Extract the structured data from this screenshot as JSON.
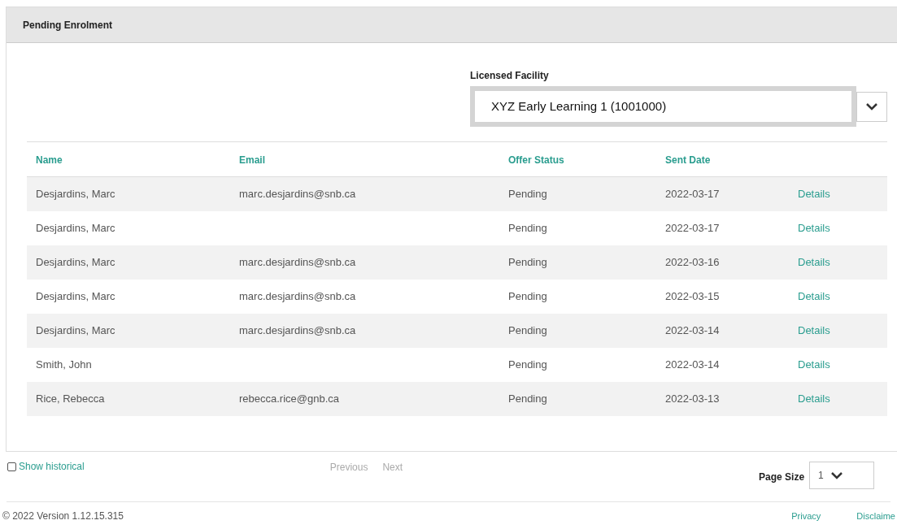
{
  "panel": {
    "title": "Pending Enrolment"
  },
  "facility": {
    "label": "Licensed Facility",
    "value": "XYZ Early Learning 1 (1001000)"
  },
  "table": {
    "columns": [
      "Name",
      "Email",
      "Offer Status",
      "Sent Date"
    ],
    "rows": [
      {
        "name": "Desjardins, Marc",
        "email": "marc.desjardins@snb.ca",
        "status": "Pending",
        "date": "2022-03-17",
        "action": "Details"
      },
      {
        "name": "Desjardins, Marc",
        "status": "Pending",
        "date": "2022-03-17",
        "action": "Details"
      },
      {
        "name": "Desjardins, Marc",
        "email": "marc.desjardins@snb.ca",
        "status": "Pending",
        "date": "2022-03-16",
        "action": "Details"
      },
      {
        "name": "Desjardins, Marc",
        "email": "marc.desjardins@snb.ca",
        "status": "Pending",
        "date": "2022-03-15",
        "action": "Details"
      },
      {
        "name": "Desjardins, Marc",
        "email": "marc.desjardins@snb.ca",
        "status": "Pending",
        "date": "2022-03-14",
        "action": "Details"
      },
      {
        "name": "Smith, John",
        "status": "Pending",
        "date": "2022-03-14",
        "action": "Details"
      },
      {
        "name": "Rice, Rebecca",
        "email": "rebecca.rice@gnb.ca",
        "status": "Pending",
        "date": "2022-03-13",
        "action": "Details"
      }
    ]
  },
  "show_historical": {
    "label": "Show historical",
    "checked": false
  },
  "pager": {
    "previous": "Previous",
    "next": "Next"
  },
  "page_size": {
    "label": "Page Size",
    "value": "1"
  },
  "footer": {
    "version": "© 2022 Version 1.12.15.315",
    "links": [
      "Privacy",
      "Disclaime"
    ]
  }
}
